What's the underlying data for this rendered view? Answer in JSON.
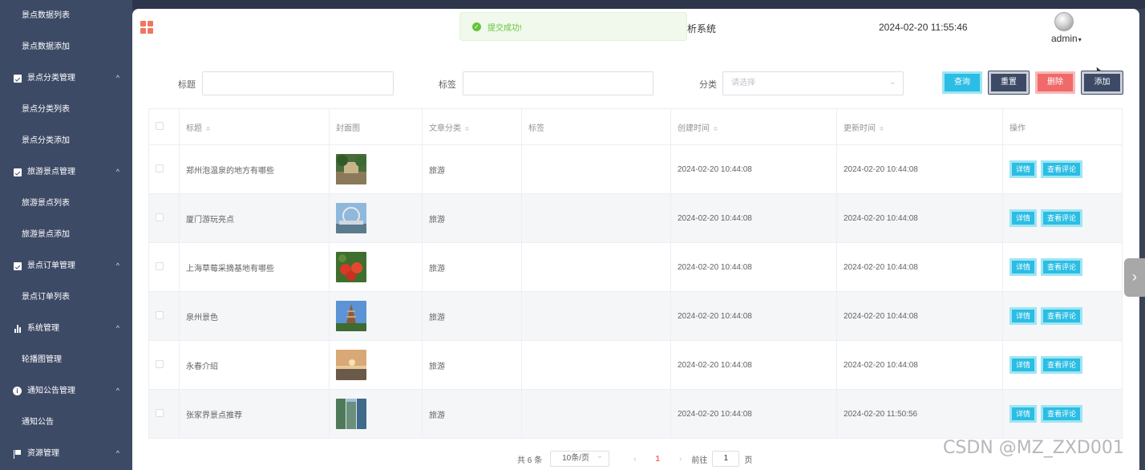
{
  "sidebar": {
    "top_items": [
      "景点数据列表",
      "景点数据添加"
    ],
    "groups": [
      {
        "label": "景点分类管理",
        "icon": "check-square-icon",
        "items": [
          "景点分类列表",
          "景点分类添加"
        ]
      },
      {
        "label": "旅游景点管理",
        "icon": "check-square-icon",
        "items": [
          "旅游景点列表",
          "旅游景点添加"
        ]
      },
      {
        "label": "景点订单管理",
        "icon": "check-square-icon",
        "items": [
          "景点订单列表"
        ]
      },
      {
        "label": "系统管理",
        "icon": "bar-chart-icon",
        "items": [
          "轮播图管理"
        ]
      },
      {
        "label": "通知公告管理",
        "icon": "info-icon",
        "items": [
          "通知公告"
        ]
      },
      {
        "label": "资源管理",
        "icon": "flag-icon",
        "items": []
      }
    ],
    "chevron": "^"
  },
  "header": {
    "system_title": "析系统",
    "datetime": "2024-02-20 11:55:46",
    "username": "admin",
    "caret": "▾"
  },
  "toast": {
    "message": "提交成功!",
    "icon": "✓"
  },
  "search": {
    "title_label": "标题",
    "tag_label": "标签",
    "category_label": "分类",
    "category_placeholder": "请选择",
    "buttons": {
      "query": "查询",
      "reset": "重置",
      "delete": "删除",
      "add": "添加"
    }
  },
  "table": {
    "columns": [
      "标题",
      "封面图",
      "文章分类",
      "标签",
      "创建时间",
      "更新时间",
      "操作"
    ],
    "sort_glyph": "≑",
    "rows": [
      {
        "title": "郑州泡温泉的地方有哪些",
        "category": "旅游",
        "tag": "",
        "created": "2024-02-20 10:44:08",
        "updated": "2024-02-20 10:44:08"
      },
      {
        "title": "厦门游玩亮点",
        "category": "旅游",
        "tag": "",
        "created": "2024-02-20 10:44:08",
        "updated": "2024-02-20 10:44:08"
      },
      {
        "title": "上海草莓采摘基地有哪些",
        "category": "旅游",
        "tag": "",
        "created": "2024-02-20 10:44:08",
        "updated": "2024-02-20 10:44:08"
      },
      {
        "title": "泉州景色",
        "category": "旅游",
        "tag": "",
        "created": "2024-02-20 10:44:08",
        "updated": "2024-02-20 10:44:08"
      },
      {
        "title": "永春介绍",
        "category": "旅游",
        "tag": "",
        "created": "2024-02-20 10:44:08",
        "updated": "2024-02-20 10:44:08"
      },
      {
        "title": "张家界景点推荐",
        "category": "旅游",
        "tag": "",
        "created": "2024-02-20 10:44:08",
        "updated": "2024-02-20 11:50:56"
      }
    ],
    "row_buttons": {
      "detail": "详情",
      "comments": "查看评论"
    }
  },
  "pagination": {
    "total": "共 6 条",
    "page_size": "10条/页",
    "prev": "‹",
    "current": "1",
    "next": "›",
    "goto_prefix": "前往",
    "goto_value": "1",
    "goto_suffix": "页"
  },
  "side_toggle": "›",
  "watermark": "CSDN @MZ_ZXD001",
  "colors": {
    "sidebar": "#3d4a66",
    "primary": "#2bbde3",
    "danger": "#f06a6a",
    "success": "#67c23a"
  }
}
